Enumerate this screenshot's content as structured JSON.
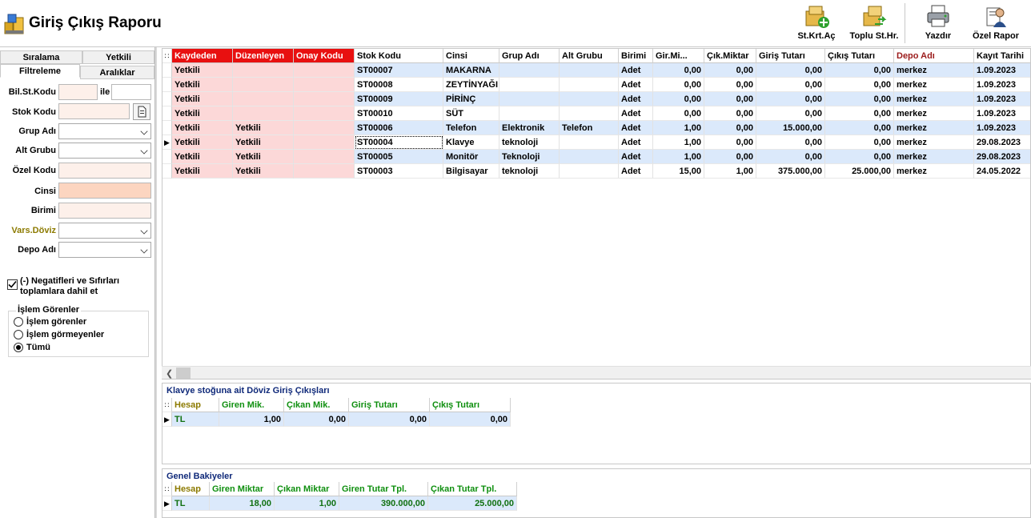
{
  "window": {
    "title": "Giriş Çıkış Raporu"
  },
  "toolbar": [
    {
      "label": "St.Krt.Aç",
      "icon": "new-stock-card-icon"
    },
    {
      "label": "Toplu St.Hr.",
      "icon": "bulk-stock-movement-icon"
    },
    {
      "label": "Yazdır",
      "icon": "printer-icon"
    },
    {
      "label": "Özel Rapor",
      "icon": "custom-report-icon"
    }
  ],
  "left_tabs": {
    "row1": [
      "Sıralama",
      "Yetkili"
    ],
    "row2": [
      "Filtreleme",
      "Aralıklar"
    ],
    "active": "Filtreleme"
  },
  "filters": {
    "bil_st_kodu": "Bil.St.Kodu",
    "ile": "ile",
    "stok_kodu": "Stok Kodu",
    "grup_adi": "Grup Adı",
    "alt_grubu": "Alt Grubu",
    "ozel_kodu": "Özel Kodu",
    "cinsi": "Cinsi",
    "birimi": "Birimi",
    "vars_doviz": "Vars.Döviz",
    "depo_adi": "Depo Adı"
  },
  "checkbox": {
    "label_line1": "(-) Negatifleri ve Sıfırları",
    "label_line2": "toplamlara dahil et",
    "checked": true
  },
  "islem_gorenler": {
    "legend": "İşlem Görenler",
    "options": [
      "İşlem görenler",
      "İşlem görmeyenler",
      "Tümü"
    ],
    "selected": "Tümü"
  },
  "main_grid": {
    "columns": [
      "Kaydeden",
      "Düzenleyen",
      "Onay Kodu",
      "Stok Kodu",
      "Cinsi",
      "Grup Adı",
      "Alt Grubu",
      "Birimi",
      "Gir.Mi...",
      "Çık.Miktar",
      "Giriş Tutarı",
      "Çıkış Tutarı",
      "Depo Adı",
      "Kayıt Tarihi"
    ],
    "rows": [
      [
        "Yetkili",
        "",
        "",
        "ST00007",
        "MAKARNA",
        "",
        "",
        "Adet",
        "0,00",
        "0,00",
        "0,00",
        "0,00",
        "merkez",
        "1.09.2023"
      ],
      [
        "Yetkili",
        "",
        "",
        "ST00008",
        "ZEYTİNYAĞI",
        "",
        "",
        "Adet",
        "0,00",
        "0,00",
        "0,00",
        "0,00",
        "merkez",
        "1.09.2023"
      ],
      [
        "Yetkili",
        "",
        "",
        "ST00009",
        "PİRİNÇ",
        "",
        "",
        "Adet",
        "0,00",
        "0,00",
        "0,00",
        "0,00",
        "merkez",
        "1.09.2023"
      ],
      [
        "Yetkili",
        "",
        "",
        "ST00010",
        "SÜT",
        "",
        "",
        "Adet",
        "0,00",
        "0,00",
        "0,00",
        "0,00",
        "merkez",
        "1.09.2023"
      ],
      [
        "Yetkili",
        "Yetkili",
        "",
        "ST00006",
        "Telefon",
        "Elektronik",
        "Telefon",
        "Adet",
        "1,00",
        "0,00",
        "15.000,00",
        "0,00",
        "merkez",
        "1.09.2023"
      ],
      [
        "Yetkili",
        "Yetkili",
        "",
        "ST00004",
        "Klavye",
        "teknoloji",
        "",
        "Adet",
        "1,00",
        "0,00",
        "0,00",
        "0,00",
        "merkez",
        "29.08.2023"
      ],
      [
        "Yetkili",
        "Yetkili",
        "",
        "ST00005",
        "Monitör",
        "Teknoloji",
        "",
        "Adet",
        "1,00",
        "0,00",
        "0,00",
        "0,00",
        "merkez",
        "29.08.2023"
      ],
      [
        "Yetkili",
        "Yetkili",
        "",
        "ST00003",
        "Bilgisayar",
        "teknoloji",
        "",
        "Adet",
        "15,00",
        "1,00",
        "375.000,00",
        "25.000,00",
        "merkez",
        "24.05.2022"
      ]
    ]
  },
  "doviz_panel": {
    "title": "Klavye stoğuna ait Döviz Giriş Çıkışları",
    "columns": [
      "Hesap",
      "Giren Mik.",
      "Çıkan Mik.",
      "Giriş Tutarı",
      "Çıkış Tutarı"
    ],
    "rows": [
      [
        "TL",
        "1,00",
        "0,00",
        "0,00",
        "0,00"
      ]
    ]
  },
  "genel_panel": {
    "title": "Genel Bakiyeler",
    "columns": [
      "Hesap",
      "Giren Miktar",
      "Çıkan Miktar",
      "Giren Tutar Tpl.",
      "Çıkan Tutar Tpl."
    ],
    "rows": [
      [
        "TL",
        "18,00",
        "1,00",
        "390.000,00",
        "25.000,00"
      ]
    ]
  }
}
